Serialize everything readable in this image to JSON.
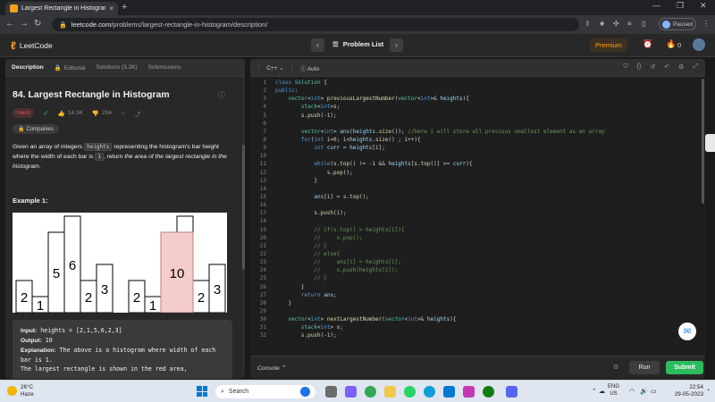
{
  "browser": {
    "tab_title": "Largest Rectangle in Histogram",
    "tab_close": "×",
    "new_tab": "+",
    "url_host": "leetcode.com",
    "url_path": "/problems/largest-rectangle-in-histogram/description/",
    "profile_status": "Paused"
  },
  "nav": {
    "logo_text": "LeetCode",
    "problem_list": "Problem List",
    "premium": "Premium",
    "streak_count": "0"
  },
  "left_tabs": [
    {
      "label": "Description"
    },
    {
      "label": "Editorial"
    },
    {
      "label": "Solutions (3.2K)"
    },
    {
      "label": "Submissions"
    }
  ],
  "problem": {
    "title": "84. Largest Rectangle in Histogram",
    "difficulty": "Hard",
    "likes": "14.3K",
    "dislikes": "204",
    "companies": "Companies",
    "desc_1": "Given an array of integers ",
    "desc_code_1": "heights",
    "desc_2": " representing the histogram's bar height where the width of each bar is ",
    "desc_code_2": "1",
    "desc_3": ", return ",
    "desc_italic": "the area of the largest rectangle in the histogram",
    "desc_4": ".",
    "example_heading": "Example 1:",
    "input_label": "Input:",
    "input_value": " heights = [2,1,5,6,2,3]",
    "output_label": "Output:",
    "output_value": " 10",
    "explanation_label": "Explanation:",
    "explanation_value": " The above is a histogram where width of each bar is 1.",
    "explanation_line2": "The largest rectangle is shown in the red area,"
  },
  "histogram": {
    "left": {
      "values": [
        2,
        1,
        5,
        6,
        2,
        3
      ],
      "labels": [
        "2",
        "1",
        "5",
        "6",
        "2",
        "3"
      ]
    },
    "right": {
      "values": [
        2,
        1,
        5,
        6,
        2,
        3
      ],
      "labels": [
        "2",
        "1",
        "",
        "",
        "2",
        "3"
      ],
      "highlight_label": "10"
    },
    "highlight_color": "#f4cccc"
  },
  "editor": {
    "language": "C++",
    "mode": "Auto",
    "lines": [
      {
        "n": "1",
        "code": "class Solution {"
      },
      {
        "n": "2",
        "code": "public:"
      },
      {
        "n": "3",
        "code": "    vector<int> previousLargestNumber(vector<int>& heights){"
      },
      {
        "n": "4",
        "code": "        stack<int>s;"
      },
      {
        "n": "5",
        "code": "        s.push(-1);"
      },
      {
        "n": "6",
        "code": ""
      },
      {
        "n": "7",
        "code": "        vector<int> ans(heights.size()); //here i will store all previous smallest element as an array"
      },
      {
        "n": "8",
        "code": "        for(int i=0; i<heights.size() ; i++){"
      },
      {
        "n": "9",
        "code": "            int curr = heights[i];"
      },
      {
        "n": "10",
        "code": ""
      },
      {
        "n": "11",
        "code": "            while(s.top() != -1 && heights[s.top()] >= curr){"
      },
      {
        "n": "12",
        "code": "                s.pop();"
      },
      {
        "n": "13",
        "code": "            }"
      },
      {
        "n": "14",
        "code": ""
      },
      {
        "n": "15",
        "code": "            ans[i] = s.top();"
      },
      {
        "n": "16",
        "code": ""
      },
      {
        "n": "17",
        "code": "            s.push(i);"
      },
      {
        "n": "18",
        "code": ""
      },
      {
        "n": "19",
        "code": "            // if(s.top() > heights[i]){"
      },
      {
        "n": "20",
        "code": "            //     s.pop();"
      },
      {
        "n": "21",
        "code": "            // }"
      },
      {
        "n": "22",
        "code": "            // else{"
      },
      {
        "n": "23",
        "code": "            //     ans[i] = heights[i];"
      },
      {
        "n": "24",
        "code": "            //     s.push(heights[i]);"
      },
      {
        "n": "25",
        "code": "            // }"
      },
      {
        "n": "26",
        "code": "        }"
      },
      {
        "n": "27",
        "code": "        return ans;"
      },
      {
        "n": "28",
        "code": "    }"
      },
      {
        "n": "29",
        "code": ""
      },
      {
        "n": "30",
        "code": "    vector<int> nextLargestNumber(vector<int>& heights){"
      },
      {
        "n": "31",
        "code": "        stack<int> s;"
      },
      {
        "n": "32",
        "code": "        s.push(-1);"
      }
    ],
    "console": "Console",
    "run": "Run",
    "submit": "Submit"
  },
  "taskbar": {
    "temp": "26°C",
    "weather": "Haze",
    "search": "Search",
    "lang_line1": "ENG",
    "lang_line2": "US",
    "time": "22:54",
    "date": "29-05-2023"
  },
  "colors": {
    "accent": "#ffa116",
    "hard": "#ef4743",
    "submit": "#2cbb5d",
    "comment": "#6a9955",
    "keyword": "#569cd6",
    "function": "#dcdcaa",
    "type": "#4ec9b0"
  }
}
